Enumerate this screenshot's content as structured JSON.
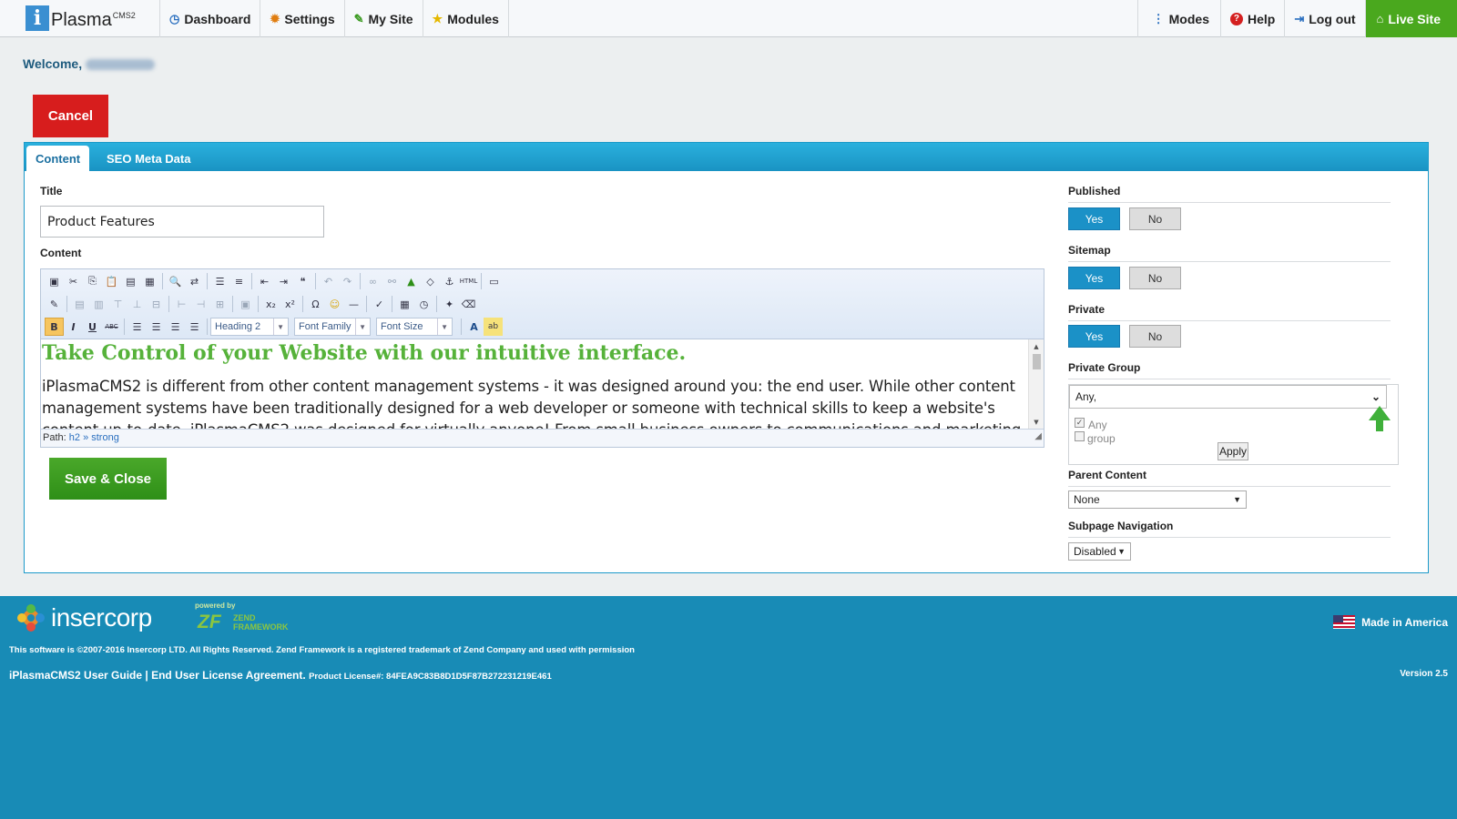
{
  "app": {
    "logo_letter": "i",
    "logo_name": "Plasma",
    "logo_sup": "CMS2"
  },
  "nav": {
    "left": [
      {
        "icon": "dashboard-icon",
        "label": "Dashboard"
      },
      {
        "icon": "gear-icon",
        "label": "Settings"
      },
      {
        "icon": "edit-icon",
        "label": "My Site"
      },
      {
        "icon": "star-icon",
        "label": "Modules"
      }
    ],
    "right": [
      {
        "icon": "more-vertical-icon",
        "label": "Modes"
      },
      {
        "icon": "help-icon",
        "label": "Help"
      },
      {
        "icon": "logout-icon",
        "label": "Log out"
      },
      {
        "icon": "home-icon",
        "label": "Live Site"
      }
    ]
  },
  "welcome": {
    "label": "Welcome,"
  },
  "actions": {
    "cancel": "Cancel",
    "save_close": "Save & Close"
  },
  "tabs": [
    {
      "label": "Content",
      "active": true
    },
    {
      "label": "SEO Meta Data",
      "active": false
    }
  ],
  "form": {
    "title_label": "Title",
    "title_value": "Product Features",
    "content_label": "Content"
  },
  "editor": {
    "format_select": "Heading 2",
    "font_family_select": "Font Family",
    "font_size_select": "Font Size",
    "heading": "Take Control of your Website with our intuitive interface.",
    "paragraph": "iPlasmaCMS2 is different from other content management systems - it was designed around you: the end user.  While other content management systems have been traditionally designed for a web developer or someone with technical skills to keep a website's content up-to-date, iPlasmaCMS2 was designed for virtually anyone!  From small business owners to communications and marketing professionals",
    "path_label": "Path:",
    "path_h2": "h2",
    "path_sep": "»",
    "path_strong": "strong"
  },
  "sidebar": {
    "published": {
      "label": "Published",
      "yes": "Yes",
      "no": "No",
      "value": "Yes"
    },
    "sitemap": {
      "label": "Sitemap",
      "yes": "Yes",
      "no": "No",
      "value": "Yes"
    },
    "private": {
      "label": "Private",
      "yes": "Yes",
      "no": "No",
      "value": "Yes"
    },
    "private_group": {
      "label": "Private Group",
      "value": "Any,",
      "options": [
        {
          "label": "Any",
          "checked": true
        },
        {
          "label": "group",
          "checked": false
        }
      ],
      "apply": "Apply"
    },
    "parent_content": {
      "label": "Parent Content",
      "value": "None"
    },
    "subpage_navigation": {
      "label": "Subpage Navigation",
      "value": "Disabled"
    }
  },
  "footer": {
    "brand": "insercorp",
    "powered_by": "powered by",
    "zf_logo": "ZF",
    "zf_name_1": "ZEND",
    "zf_name_2": "FRAMEWORK",
    "made_in": "Made in America",
    "copyright": "This software is ©2007-2016 Insercorp LTD. All Rights Reserved. Zend Framework is a registered trademark of Zend Company and used with permission",
    "user_guide": "iPlasmaCMS2 User Guide",
    "sep": " | ",
    "eula": "End User License Agreement.",
    "license": "Product License#: 84FEA9C83B8D1D5F87B272231219E461",
    "version": "Version 2.5"
  },
  "colors": {
    "accent": "#1b91c7",
    "cancel": "#d71d1d",
    "save": "#3a9a20",
    "live_site": "#4aa81e",
    "heading_green": "#56b23a",
    "footer_bg": "#188bb6"
  }
}
